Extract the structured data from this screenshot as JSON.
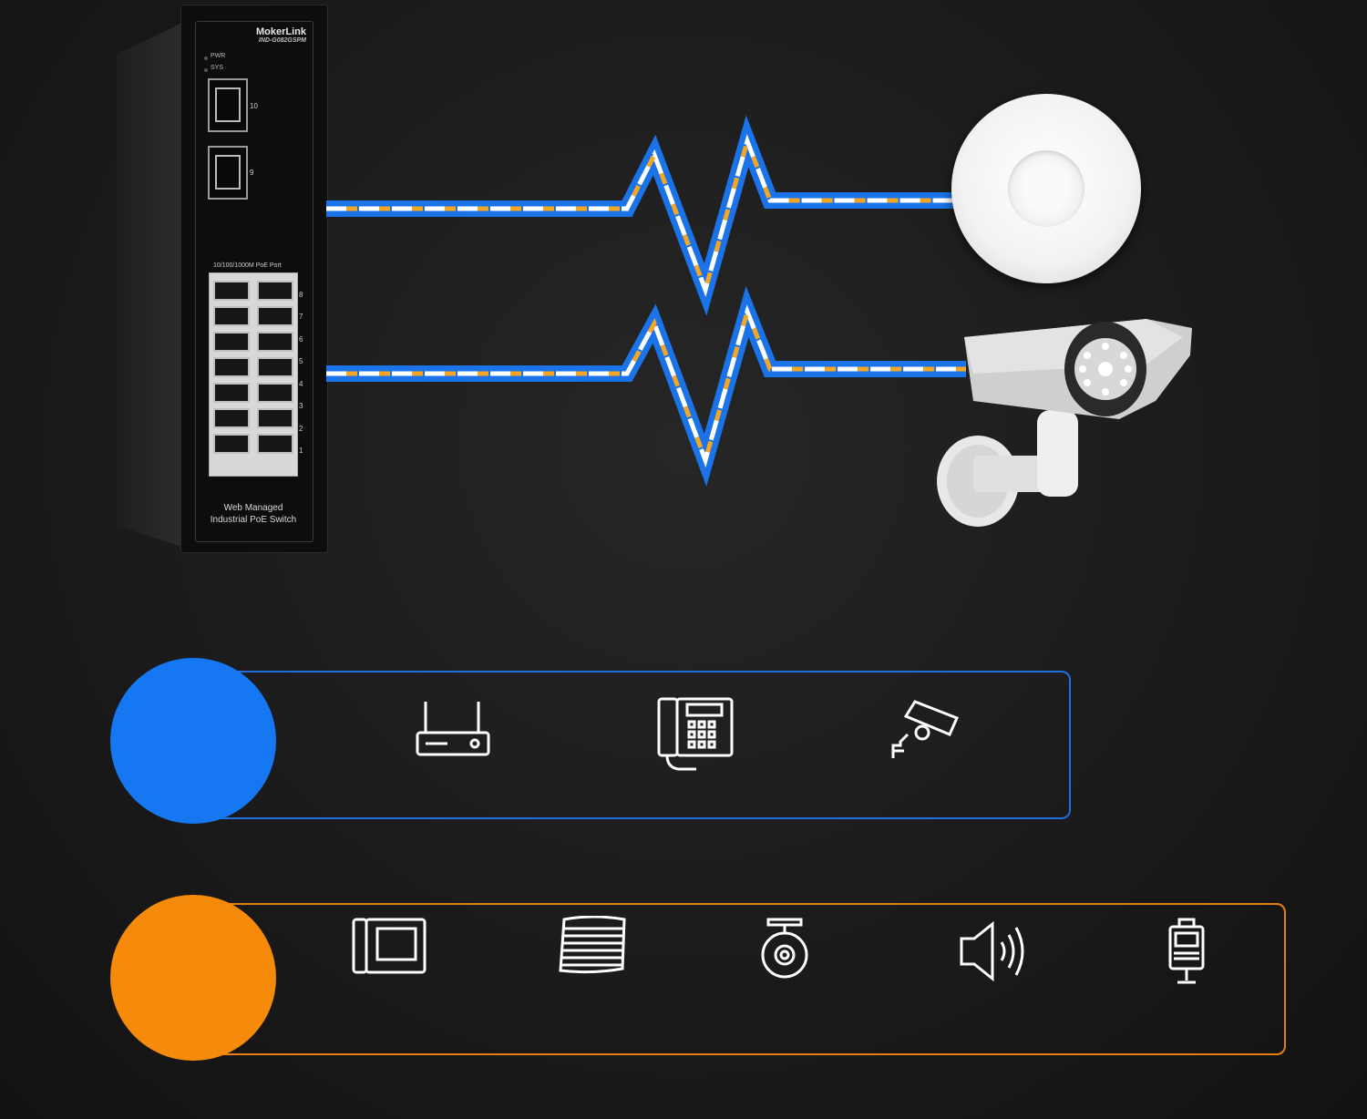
{
  "switch": {
    "brand": "MokerLink",
    "model": "IND-G082GSPM",
    "led_labels": [
      "PWR",
      "SYS"
    ],
    "sfp_ports": [
      "10",
      "9"
    ],
    "port_label": "10/100/1000M PoE Port",
    "port_numbers": [
      "8",
      "7",
      "6",
      "5",
      "4",
      "3",
      "2",
      "1"
    ],
    "footer_line1": "Web Managed",
    "footer_line2": "Industrial PoE Switch"
  },
  "panels": {
    "top": {
      "color": "#1677f2",
      "icons": [
        "router-icon",
        "ip-phone-icon",
        "security-camera-icon"
      ]
    },
    "bottom": {
      "color": "#f58a0b",
      "icons": [
        "intercom-icon",
        "panel-antenna-icon",
        "dashcam-icon",
        "speaker-icon",
        "kiosk-icon"
      ]
    }
  },
  "colors": {
    "cable_blue": "#1a73e8",
    "arrow_orange": "#f5a623",
    "background": "#1a1a1a"
  }
}
